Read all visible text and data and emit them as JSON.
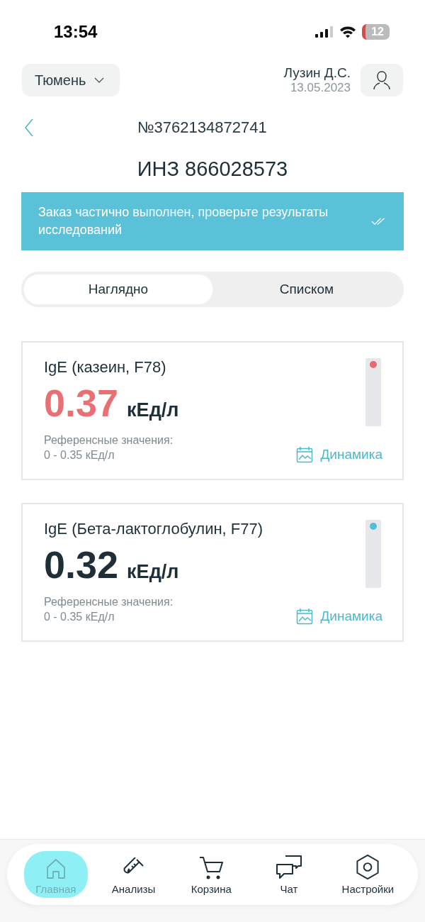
{
  "status_bar": {
    "time": "13:54",
    "battery": "12"
  },
  "header": {
    "city": "Тюмень",
    "user_name": "Лузин Д.С.",
    "date": "13.05.2023"
  },
  "order": {
    "number": "№3762134872741",
    "title": "ИНЗ 866028573"
  },
  "notice": {
    "text": "Заказ частично выполнен, проверьте результаты исследований"
  },
  "tabs": [
    {
      "label": "Наглядно",
      "selected": true
    },
    {
      "label": "Списком",
      "selected": false
    }
  ],
  "results": [
    {
      "name": "IgE (казеин, F78)",
      "value": "0.37",
      "unit": "кЕд/л",
      "reference_label": "Референсные значения:",
      "reference_range": "0 - 0.35 кЕд/л",
      "out_of_range": true,
      "link": "Динамика"
    },
    {
      "name": "IgE (Бета-лактоглобулин, F77)",
      "value": "0.32",
      "unit": "кЕд/л",
      "reference_label": "Референсные значения:",
      "reference_range": "0 - 0.35 кЕд/л",
      "out_of_range": false,
      "link": "Динамика"
    }
  ],
  "nav": [
    {
      "kind": "home",
      "label": "Главная",
      "selected": true
    },
    {
      "kind": "tests",
      "label": "Анализы",
      "selected": false
    },
    {
      "kind": "cart",
      "label": "Корзина",
      "selected": false
    },
    {
      "kind": "chat",
      "label": "Чат",
      "selected": false
    },
    {
      "kind": "settings",
      "label": "Настройки",
      "selected": false
    }
  ]
}
